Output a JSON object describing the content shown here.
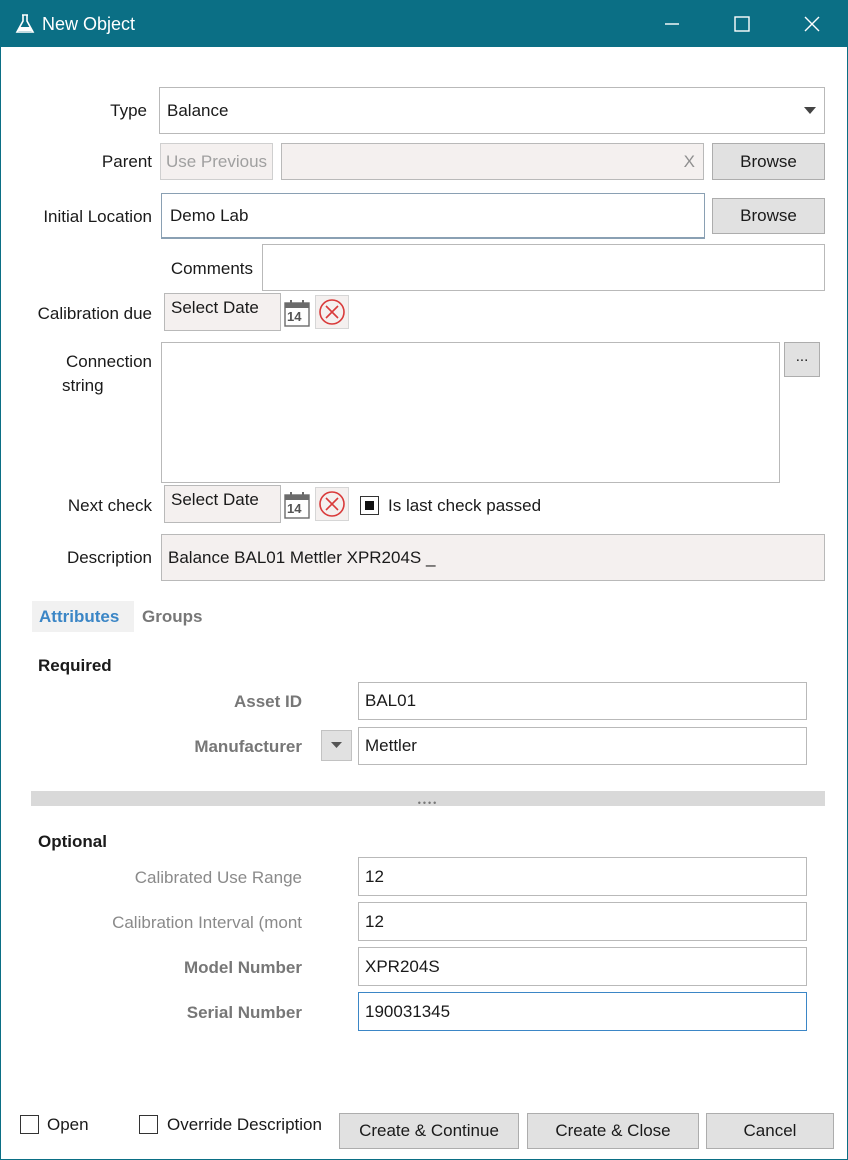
{
  "window": {
    "title": "New Object",
    "controls": [
      "minimize",
      "maximize",
      "close"
    ]
  },
  "form": {
    "type": {
      "label": "Type",
      "value": "Balance"
    },
    "parent": {
      "label": "Parent",
      "use_previous": "Use Previous",
      "value": "",
      "clear": "X",
      "browse": "Browse"
    },
    "initial_location": {
      "label": "Initial Location",
      "value": "Demo Lab",
      "browse": "Browse"
    },
    "comments": {
      "label": "Comments",
      "value": ""
    },
    "calibration_due": {
      "label": "Calibration due",
      "value": "Select Date",
      "calendar_day": "14"
    },
    "connection_string": {
      "label_line1": "Connection",
      "label_line2": "string",
      "value": "",
      "more": "..."
    },
    "next_check": {
      "label": "Next check",
      "value": "Select Date",
      "calendar_day": "14"
    },
    "last_check": {
      "label": "Is last check passed",
      "checked": true
    },
    "description": {
      "label": "Description",
      "value": "Balance BAL01 Mettler XPR204S _"
    }
  },
  "tabs": {
    "attributes": "Attributes",
    "groups": "Groups"
  },
  "required": {
    "heading": "Required",
    "asset_id": {
      "label": "Asset ID",
      "value": "BAL01"
    },
    "manufacturer": {
      "label": "Manufacturer",
      "value": "Mettler"
    }
  },
  "splitter": {
    "grip": "••••"
  },
  "optional": {
    "heading": "Optional",
    "calibrated_use_range": {
      "label": "Calibrated Use Range",
      "value": "12"
    },
    "calibration_interval": {
      "label": "Calibration Interval (mont",
      "value": "12"
    },
    "model_number": {
      "label": "Model Number",
      "value": "XPR204S"
    },
    "serial_number": {
      "label": "Serial Number",
      "value": "190031345"
    }
  },
  "footer": {
    "open": {
      "label": "Open",
      "checked": false
    },
    "override_description": {
      "label": "Override Description",
      "checked": false
    },
    "create_continue": "Create & Continue",
    "create_close": "Create & Close",
    "cancel": "Cancel"
  },
  "colors": {
    "titlebar": "#0b6f85",
    "tab_active": "#3b86c6",
    "focus_border": "#3b86c6",
    "clear_icon": "#d93a3a"
  }
}
